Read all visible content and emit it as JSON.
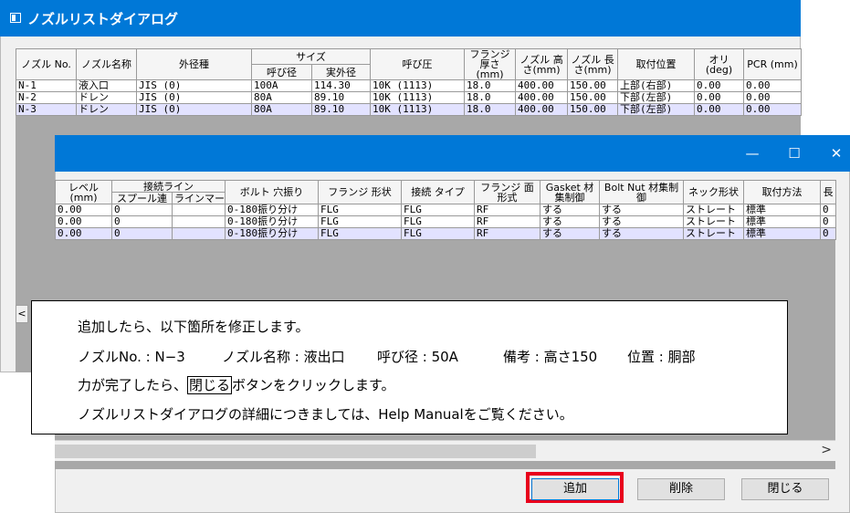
{
  "back_dialog": {
    "title": "ノズルリストダイアログ",
    "headers": {
      "nozzle_no": "ノズル No.",
      "nozzle_name": "ノズル名称",
      "outer_type": "外径種",
      "size": "サイズ",
      "size_nominal": "呼び径",
      "size_outer": "実外径",
      "nominal_pressure": "呼び圧",
      "flange_thickness": "フランジ 厚さ(mm)",
      "nozzle_height": "ノズル 高さ(mm)",
      "nozzle_length": "ノズル 長さ(mm)",
      "mount_position": "取付位置",
      "ori": "オリ (deg)",
      "pcr": "PCR (mm)"
    },
    "rows": [
      {
        "no": "N-1",
        "name": "液入口",
        "outer": "JIS (0)",
        "nominal": "100A",
        "od": "114.30",
        "pressure": "10K (1113)",
        "thk": "18.0",
        "height": "400.00",
        "length": "150.00",
        "pos": "上部(右部)",
        "ori": "0.00",
        "pcr": "0.00"
      },
      {
        "no": "N-2",
        "name": "ドレン",
        "outer": "JIS (0)",
        "nominal": "80A",
        "od": "89.10",
        "pressure": "10K (1113)",
        "thk": "18.0",
        "height": "400.00",
        "length": "150.00",
        "pos": "下部(左部)",
        "ori": "0.00",
        "pcr": "0.00"
      },
      {
        "no": "N-3",
        "name": "ドレン",
        "outer": "JIS (0)",
        "nominal": "80A",
        "od": "89.10",
        "pressure": "10K (1113)",
        "thk": "18.0",
        "height": "400.00",
        "length": "150.00",
        "pos": "下部(左部)",
        "ori": "0.00",
        "pcr": "0.00"
      }
    ]
  },
  "front_dialog": {
    "window_buttons": {
      "minimize": "—",
      "maximize": "☐",
      "close": "✕"
    },
    "headers": {
      "level": "レベル (mm)",
      "connection_line": "接続ライン",
      "spool_ren": "スプール連",
      "line_mark": "ラインマーク",
      "bolt_hole": "ボルト 穴振り",
      "flange_type": "フランジ 形状",
      "connection_type": "接続 タイプ",
      "flange_face": "フランジ 面形式",
      "gasket": "Gasket 材集制御",
      "bolt_nut": "Bolt Nut 材集制御",
      "neck_shape": "ネック形状",
      "mount_method": "取付方法",
      "cut": "長"
    },
    "rows": [
      {
        "level": "0.00",
        "spool": "0",
        "mark": "",
        "bolt": "0-180振り分け",
        "flange": "FLG",
        "conn": "FLG",
        "face": "RF",
        "gasket": "する",
        "boltnut": "する",
        "neck": "ストレート",
        "method": "標準",
        "cut": "0"
      },
      {
        "level": "0.00",
        "spool": "0",
        "mark": "",
        "bolt": "0-180振り分け",
        "flange": "FLG",
        "conn": "FLG",
        "face": "RF",
        "gasket": "する",
        "boltnut": "する",
        "neck": "ストレート",
        "method": "標準",
        "cut": "0"
      },
      {
        "level": "0.00",
        "spool": "0",
        "mark": "",
        "bolt": "0-180振り分け",
        "flange": "FLG",
        "conn": "FLG",
        "face": "RF",
        "gasket": "する",
        "boltnut": "する",
        "neck": "ストレート",
        "method": "標準",
        "cut": "0"
      }
    ],
    "buttons": {
      "add": "追加",
      "delete": "削除",
      "close": "閉じる"
    },
    "scroll_arrow": ">"
  },
  "back_scroll_arrow": "<",
  "note": {
    "line1": "追加したら、以下箇所を修正します。",
    "line2_a": "ノズルNo. :  N−3",
    "line2_b": "ノズル名称 : 液出口",
    "line2_c": "呼び径 :  50A",
    "line2_d": "備考 : 高さ150",
    "line2_e": "位置 :  胴部",
    "line3_pre": "力が完了したら、",
    "line3_box": "閉じる",
    "line3_post": "ボタンをクリックします。",
    "line4": "ノズルリストダイアログの詳細につきましては、Help Manualをご覧ください。"
  }
}
